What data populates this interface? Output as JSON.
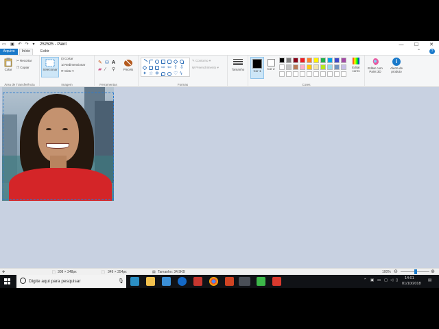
{
  "window": {
    "title": "252525 - Paint",
    "controls": {
      "minimize": "—",
      "maximize": "☐",
      "close": "✕"
    }
  },
  "tabs": {
    "file": "Arquivo",
    "home": "Início",
    "view": "Exibir"
  },
  "ribbon": {
    "clipboard": {
      "paste": "Colar",
      "cut": "Recortar",
      "copy": "Copiar",
      "label": "Área de Transferência"
    },
    "image": {
      "select": "Selecionar",
      "crop": "Cortar",
      "resize": "Redimensionar",
      "rotate": "Girar",
      "label": "Imagem"
    },
    "tools": {
      "label": "Ferramentas",
      "brushes": "Pincéis"
    },
    "shapes": {
      "outline": "Contorno",
      "fill": "Preenchimento",
      "label": "Formas"
    },
    "size": {
      "label": "Tamanho"
    },
    "colors": {
      "color1": "Cor 1",
      "color2": "Cor 2",
      "label": "Cores",
      "edit": "Editar cores",
      "palette_row1": [
        "#000000",
        "#7f7f7f",
        "#880015",
        "#ed1c24",
        "#ff7f27",
        "#fff200",
        "#22b14c",
        "#00a2e8",
        "#3f48cc",
        "#a349a4"
      ],
      "palette_row2": [
        "#ffffff",
        "#c3c3c3",
        "#b97a57",
        "#ffaec9",
        "#ffc90e",
        "#efe4b0",
        "#b5e61d",
        "#99d9ea",
        "#7092be",
        "#c8bfe7"
      ],
      "color1_value": "#000000",
      "color2_value": "#ffffff"
    },
    "paint3d": "Editar com Paint 3D",
    "alert": "Alerta de produto"
  },
  "statusbar": {
    "cursor_pos": "308 × 348px",
    "selection_size": "349 × 354px",
    "file_size": "Tamanho: 34,9KB",
    "zoom": "100%"
  },
  "taskbar": {
    "search_placeholder": "Digite aqui para pesquisar",
    "time": "14:01",
    "date": "01/10/2018"
  }
}
